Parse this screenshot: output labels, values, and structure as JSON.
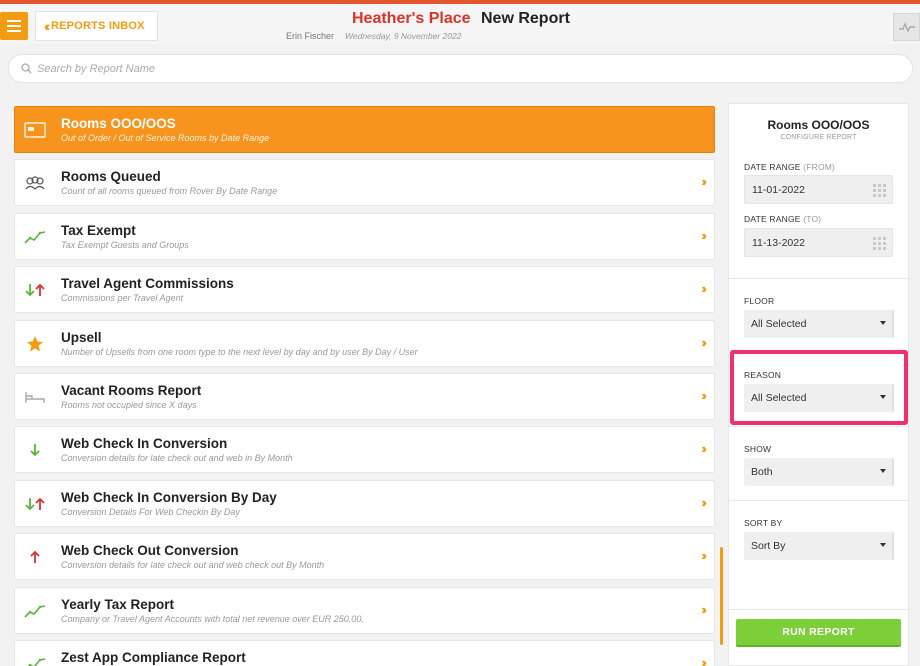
{
  "header": {
    "inbox_label": "REPORTS INBOX",
    "hotel_name": "Heather's Place",
    "report_title": "New Report",
    "user_name": "Erin Fischer",
    "date": "Wednesday, 9 November 2022"
  },
  "search": {
    "placeholder": "Search by Report Name"
  },
  "reports": [
    {
      "title": "Rooms OOO/OOS",
      "subtitle": "Out of Order / Out of Service Rooms by Date Range",
      "icon": "bed-icon",
      "active": true
    },
    {
      "title": "Rooms Queued",
      "subtitle": "Count of all rooms queued from Rover By Date Range",
      "icon": "people-icon"
    },
    {
      "title": "Tax Exempt",
      "subtitle": "Tax Exempt Guests and Groups",
      "icon": "trend-up-icon"
    },
    {
      "title": "Travel Agent Commissions",
      "subtitle": "Commissions per Travel Agent",
      "icon": "arrows-up-down-icon"
    },
    {
      "title": "Upsell",
      "subtitle": "Number of Upsells from one room type to the next level by day and by user By Day / User",
      "icon": "star-icon"
    },
    {
      "title": "Vacant Rooms Report",
      "subtitle": "Rooms not occupied since X days",
      "icon": "bed-outline-icon"
    },
    {
      "title": "Web Check In Conversion",
      "subtitle": "Conversion details for late check out and web in By Month",
      "icon": "arrow-down-icon"
    },
    {
      "title": "Web Check In Conversion By Day",
      "subtitle": "Conversion Details For Web Checkin By Day",
      "icon": "arrows-up-down-icon"
    },
    {
      "title": "Web Check Out Conversion",
      "subtitle": "Conversion details for late check out and web check out By Month",
      "icon": "arrow-up-icon"
    },
    {
      "title": "Yearly Tax Report",
      "subtitle": "Company or Travel Agent Accounts with total net revenue over EUR 250.00.",
      "icon": "trend-up-icon"
    },
    {
      "title": "Zest App Compliance Report",
      "subtitle": "",
      "icon": "trend-up-icon"
    }
  ],
  "panel": {
    "title": "Rooms OOO/OOS",
    "subtitle": "CONFIGURE REPORT",
    "date_from_label": "DATE RANGE",
    "date_from_hint": "(FROM)",
    "date_from_value": "11-01-2022",
    "date_to_label": "DATE RANGE",
    "date_to_hint": "(TO)",
    "date_to_value": "11-13-2022",
    "floor_label": "FLOOR",
    "floor_value": "All Selected",
    "reason_label": "REASON",
    "reason_value": "All Selected",
    "show_label": "SHOW",
    "show_value": "Both",
    "sort_label": "SORT BY",
    "sort_value": "Sort By",
    "run_label": "RUN REPORT"
  },
  "colors": {
    "accent": "#f39c12",
    "active_item": "#f7941d",
    "hotel_name": "#d9342b",
    "run_button": "#7dcf3a",
    "highlight": "#f0306b"
  }
}
